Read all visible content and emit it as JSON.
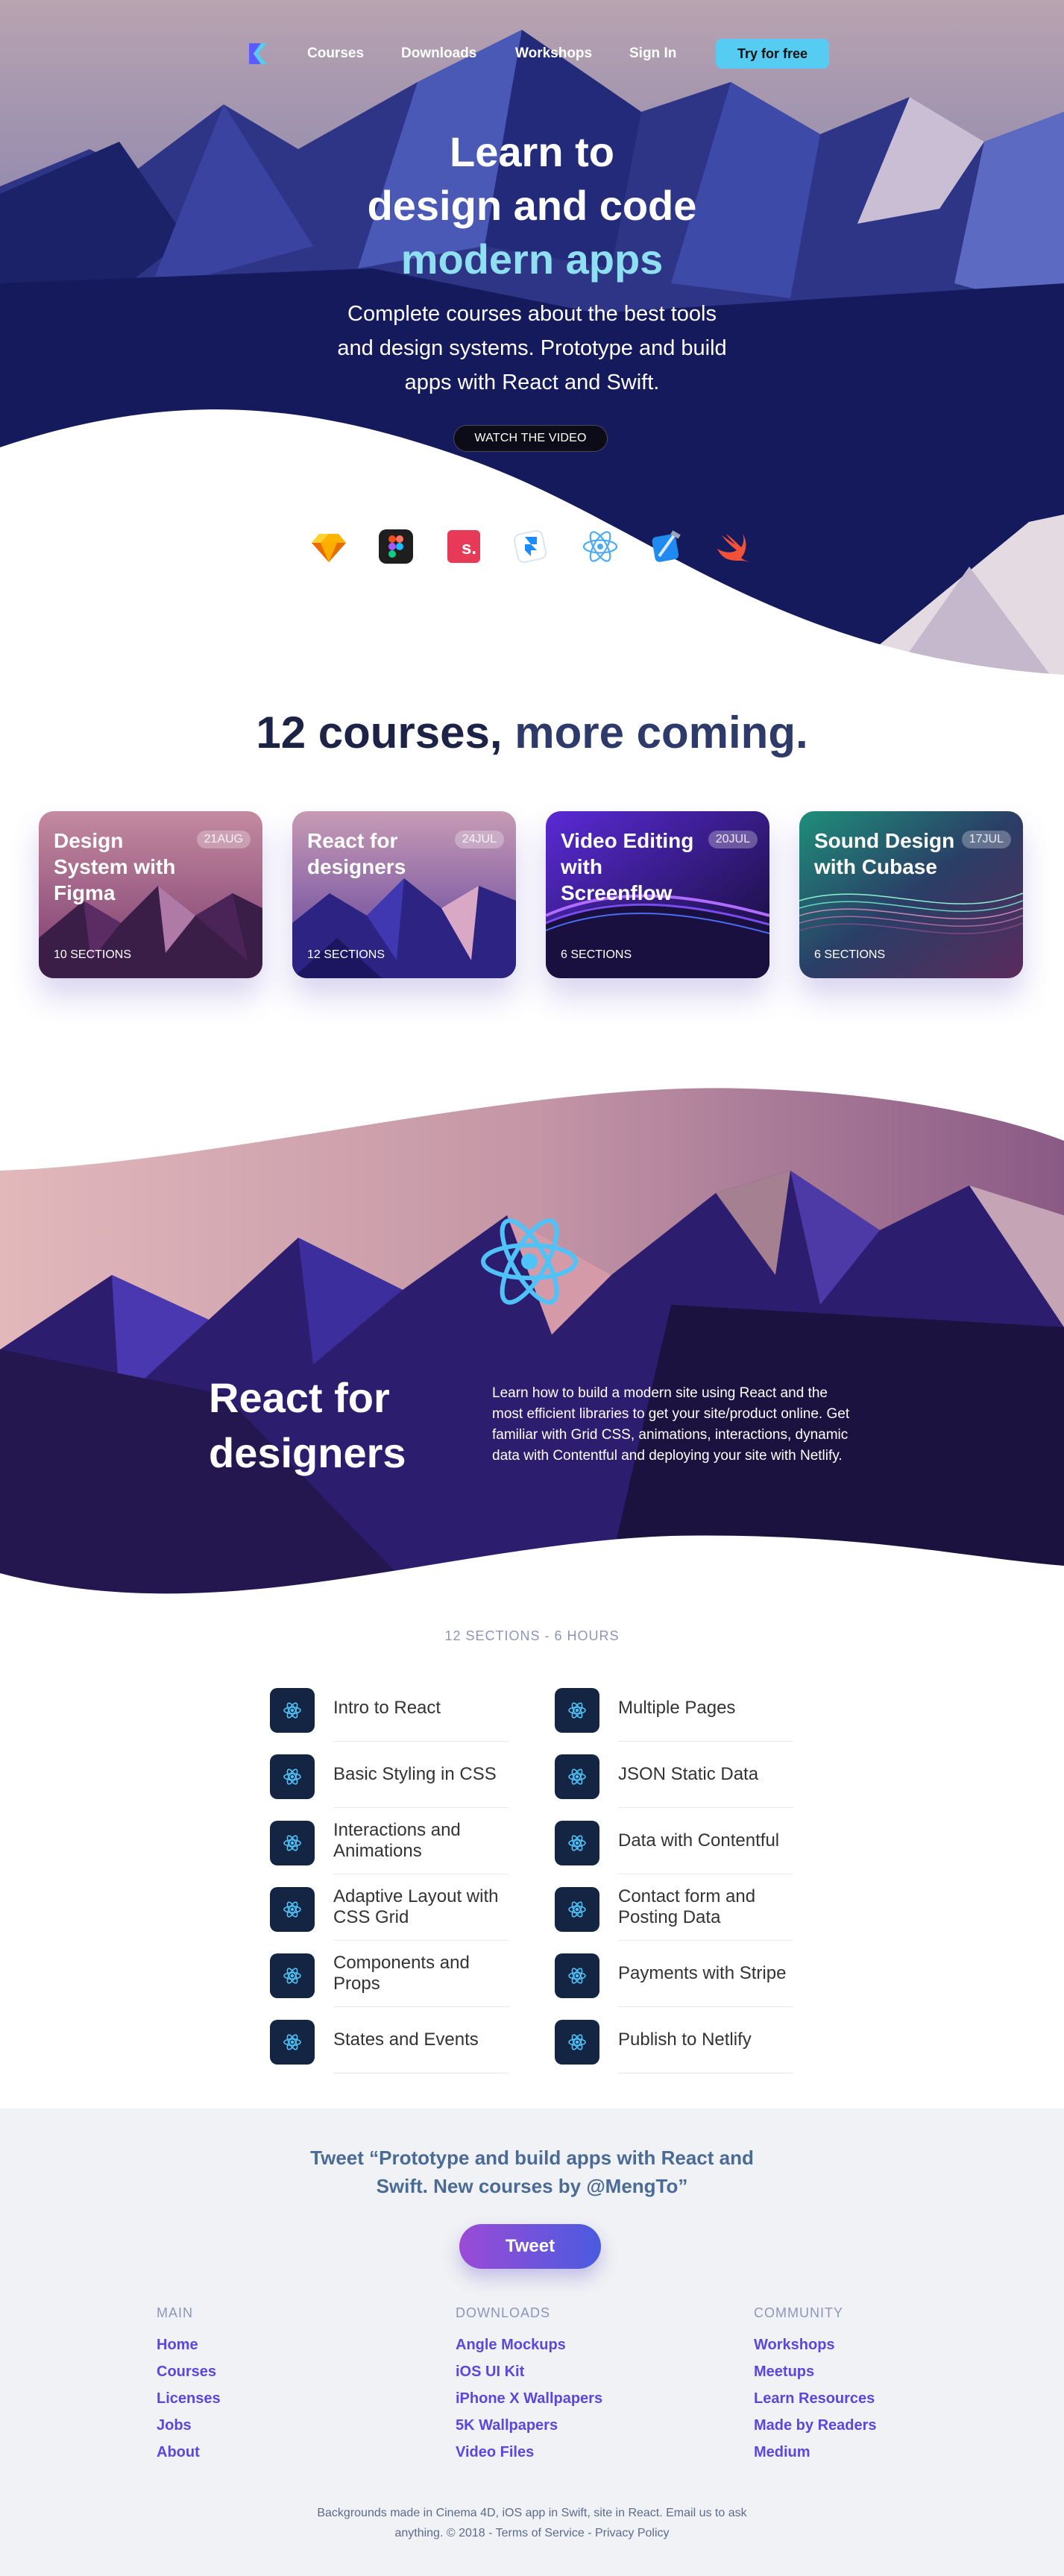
{
  "nav": {
    "links": [
      "Courses",
      "Downloads",
      "Workshops",
      "Sign In"
    ],
    "cta": "Try for free",
    "accent": "#56ccf2"
  },
  "hero": {
    "title_line1": "Learn to",
    "title_line2": "design and code",
    "title_line3": "modern apps",
    "subtitle": "Complete courses about the best tools and design systems. Prototype and build apps with React and Swift.",
    "watch_button": "WATCH THE VIDEO",
    "tool_icons": [
      "sketch-icon",
      "figma-icon",
      "studio-icon",
      "framer-icon",
      "react-icon",
      "xcode-icon",
      "swift-icon"
    ]
  },
  "courses": {
    "heading_main": "12 courses,",
    "heading_rest": "more coming.",
    "cards": [
      {
        "title": "Design System with Figma",
        "date": "21AUG",
        "sections": "10 SECTIONS"
      },
      {
        "title": "React for designers",
        "date": "24JUL",
        "sections": "12 SECTIONS"
      },
      {
        "title": "Video Editing with Screenflow",
        "date": "20JUL",
        "sections": "6 SECTIONS"
      },
      {
        "title": "Sound Design with Cubase",
        "date": "17JUL",
        "sections": "6 SECTIONS"
      }
    ]
  },
  "react_section": {
    "title": "React for designers",
    "description": "Learn how to build a modern site using React and the most efficient libraries to get your site/product online. Get familiar with Grid CSS, animations, interactions, dynamic data with Contentful and deploying your site with Netlify.",
    "caption": "12 SECTIONS - 6 HOURS",
    "sections_left": [
      "Intro to React",
      "Basic Styling in CSS",
      "Interactions and Animations",
      "Adaptive Layout with CSS Grid",
      "Components and Props",
      "States and Events"
    ],
    "sections_right": [
      "Multiple Pages",
      "JSON Static Data",
      "Data with Contentful",
      "Contact form and Posting Data",
      "Payments with Stripe",
      "Publish to Netlify"
    ]
  },
  "footer": {
    "tweet_quote": "Tweet “Prototype and build apps with React and Swift. New courses by @MengTo”",
    "tweet_button": "Tweet",
    "columns": [
      {
        "heading": "MAIN",
        "links": [
          "Home",
          "Courses",
          "Licenses",
          "Jobs",
          "About"
        ]
      },
      {
        "heading": "DOWNLOADS",
        "links": [
          "Angle Mockups",
          "iOS UI Kit",
          "iPhone X Wallpapers",
          "5K Wallpapers",
          "Video Files"
        ]
      },
      {
        "heading": "COMMUNITY",
        "links": [
          "Workshops",
          "Meetups",
          "Learn Resources",
          "Made by Readers",
          "Medium"
        ]
      }
    ],
    "note": "Backgrounds made in Cinema 4D, iOS app in Swift, site in React. Email us to ask anything. © 2018 - Terms of Service - Privacy Policy"
  }
}
